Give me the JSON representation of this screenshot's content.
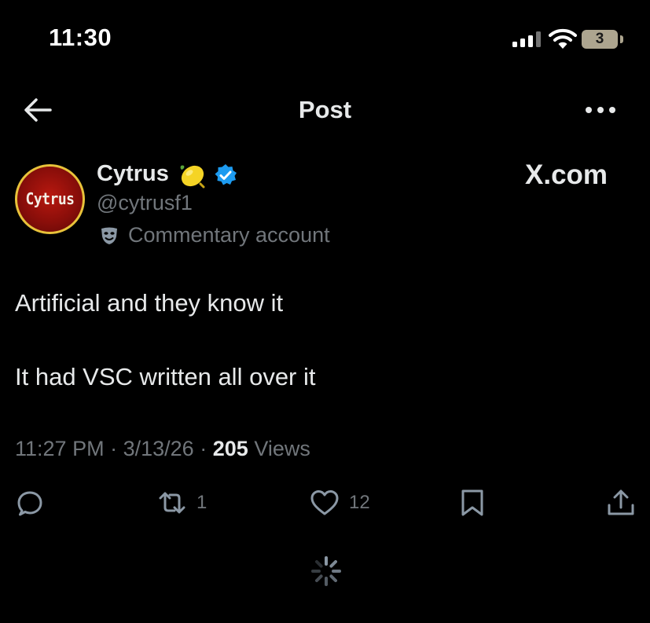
{
  "status_bar": {
    "time": "11:30",
    "battery": "3",
    "icons": [
      "signal-icon",
      "wifi-icon",
      "battery-icon"
    ]
  },
  "header": {
    "title": "Post",
    "icons": [
      "back-arrow-icon",
      "more-icon"
    ]
  },
  "author": {
    "display_name": "Cytrus",
    "avatar_text": "Cytrus",
    "handle": "@cytrusf1",
    "label": "Commentary account",
    "badges": [
      "lemon-emoji-icon",
      "verified-badge-icon",
      "mask-icon"
    ]
  },
  "watermark": "X.com",
  "tweet": {
    "lines": [
      "Artificial and they know it",
      "It had VSC written all over it"
    ]
  },
  "meta": {
    "time": "11:27 PM",
    "separator": "·",
    "date": "3/13/26",
    "views_count": "205",
    "views_label": "Views"
  },
  "actions": {
    "reply": "",
    "retweet": "1",
    "like": "12",
    "icons": [
      "reply-icon",
      "retweet-icon",
      "like-icon",
      "bookmark-icon",
      "share-icon"
    ]
  },
  "colors": {
    "background": "#000000",
    "text": "#e7e9ea",
    "muted": "#71767b",
    "verified": "#1d9bf0",
    "avatar_ring": "#e8c23a",
    "avatar_fill": "#b8180f",
    "battery": "#ada58f"
  }
}
